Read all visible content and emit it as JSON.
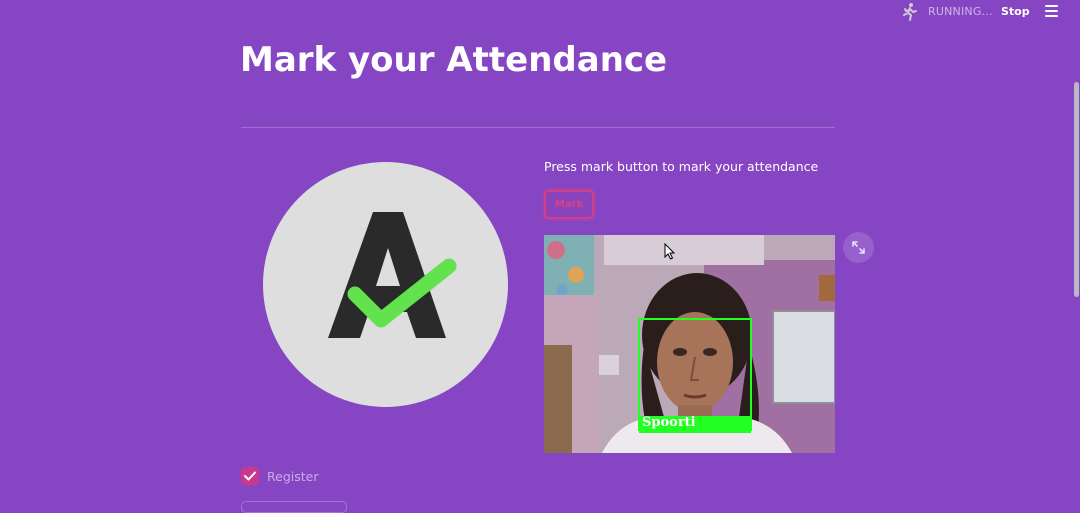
{
  "status": {
    "running_label": "RUNNING...",
    "stop_label": "Stop",
    "runner_icon": "running-man-icon",
    "menu_icon": "hamburger-menu-icon"
  },
  "page": {
    "title": "Mark your Attendance"
  },
  "logo": {
    "letter": "A",
    "check_color": "#62e24c"
  },
  "attendance": {
    "instruction": "Press mark button to mark your attendance",
    "mark_button_label": "Mark",
    "expand_icon": "fullscreen-icon"
  },
  "camera": {
    "detected_name": "Spoorti",
    "box_color": "#22ff22"
  },
  "register": {
    "label": "Register",
    "checked": true
  },
  "colors": {
    "background": "#8646c4",
    "accent": "#d63e86"
  }
}
